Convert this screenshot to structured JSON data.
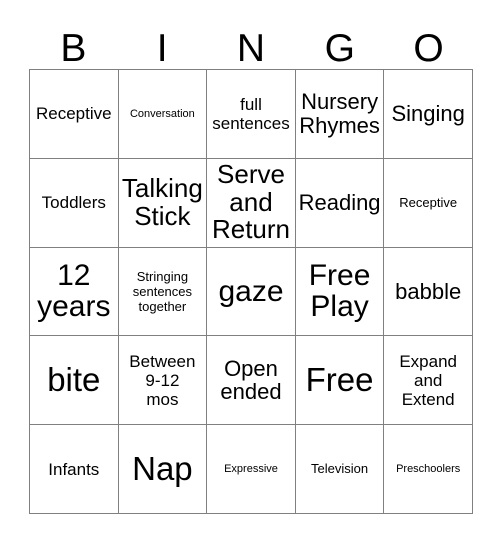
{
  "card": {
    "title": "BINGO Card",
    "header_letters": [
      "B",
      "I",
      "N",
      "G",
      "O"
    ],
    "grid_size": "5x5",
    "colors": {
      "background": "#ffffff",
      "text": "#000000",
      "border": "#808080"
    },
    "rows": [
      [
        {
          "text": "Receptive",
          "size": "md"
        },
        {
          "text": "Conversation",
          "size": "xs"
        },
        {
          "text": "full\nsentences",
          "size": "md"
        },
        {
          "text": "Nursery\nRhymes",
          "size": "lg"
        },
        {
          "text": "Singing",
          "size": "lg"
        }
      ],
      [
        {
          "text": "Toddlers",
          "size": "md"
        },
        {
          "text": "Talking\nStick",
          "size": "xl"
        },
        {
          "text": "Serve\nand\nReturn",
          "size": "xl"
        },
        {
          "text": "Reading",
          "size": "lg"
        },
        {
          "text": "Receptive",
          "size": "sm"
        }
      ],
      [
        {
          "text": "12\nyears",
          "size": "xxl"
        },
        {
          "text": "Stringing\nsentences\ntogether",
          "size": "sm"
        },
        {
          "text": "gaze",
          "size": "xxl"
        },
        {
          "text": "Free\nPlay",
          "size": "xxl"
        },
        {
          "text": "babble",
          "size": "lg"
        }
      ],
      [
        {
          "text": "bite",
          "size": "huge"
        },
        {
          "text": "Between\n9-12\nmos",
          "size": "md"
        },
        {
          "text": "Open\nended",
          "size": "lg"
        },
        {
          "text": "Free",
          "size": "huge"
        },
        {
          "text": "Expand\nand\nExtend",
          "size": "md"
        }
      ],
      [
        {
          "text": "Infants",
          "size": "md"
        },
        {
          "text": "Nap",
          "size": "huge"
        },
        {
          "text": "Expressive",
          "size": "xs"
        },
        {
          "text": "Television",
          "size": "sm"
        },
        {
          "text": "Preschoolers",
          "size": "xs"
        }
      ]
    ]
  }
}
